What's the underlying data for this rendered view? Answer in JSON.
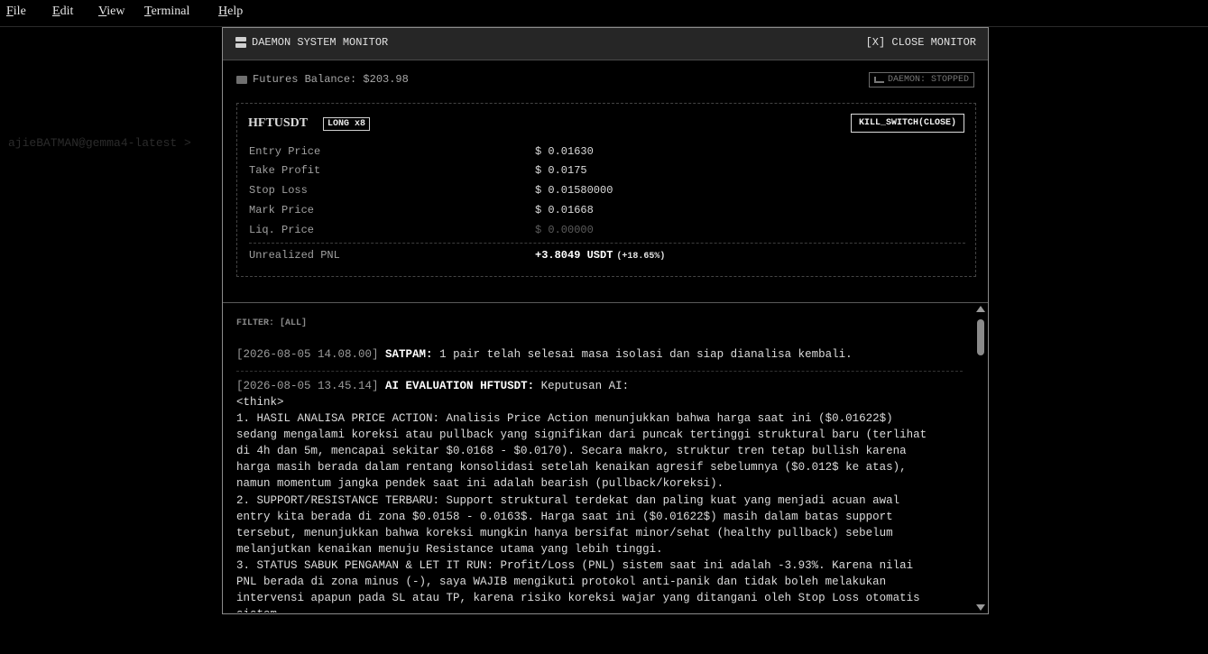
{
  "menu": {
    "items": [
      {
        "accel": "F",
        "rest": "ile"
      },
      {
        "accel": "E",
        "rest": "dit"
      },
      {
        "accel": "V",
        "rest": "iew"
      },
      {
        "accel": "T",
        "rest": "erminal"
      },
      {
        "accel": "H",
        "rest": "elp"
      }
    ]
  },
  "background": {
    "prompt": "ajieBATMAN@gemma4-latest >"
  },
  "monitor": {
    "title": "DAEMON SYSTEM MONITOR",
    "close_label": "[X] CLOSE MONITOR",
    "balance": "Futures Balance: $203.98",
    "daemon_status": "DAEMON: STOPPED",
    "position": {
      "symbol": "HFTUSDT",
      "side": "LONG x8",
      "kill_switch": "KILL_SWITCH(CLOSE)",
      "entry_label": "Entry Price",
      "entry_value": "$ 0.01630",
      "tp_label": "Take Profit",
      "tp_value": "$ 0.0175",
      "sl_label": "Stop Loss",
      "sl_value": "$ 0.01580000",
      "mark_label": "Mark Price",
      "mark_value": "$ 0.01668",
      "liq_label": "Liq. Price",
      "liq_value": "$ 0.00000",
      "pnl_label": "Unrealized PNL",
      "pnl_value": "+3.8049 USDT",
      "pnl_pct": "(+18.65%)"
    },
    "log": {
      "filter": "FILTER: [ALL]",
      "entries": [
        {
          "timestamp": "[2026-08-05 14.08.00]",
          "tag": "SATPAM:",
          "message": "1 pair telah selesai masa isolasi dan siap dianalisa kembali."
        },
        {
          "timestamp": "[2026-08-05 13.45.14]",
          "tag": "AI EVALUATION HFTUSDT:",
          "message": "Keputusan AI:",
          "body": "<think>\n1. HASIL ANALISA PRICE ACTION: Analisis Price Action menunjukkan bahwa harga saat ini ($0.01622$)\nsedang mengalami koreksi atau pullback yang signifikan dari puncak tertinggi struktural baru (terlihat\ndi 4h dan 5m, mencapai sekitar $0.0168 - $0.0170). Secara makro, struktur tren tetap bullish karena\nharga masih berada dalam rentang konsolidasi setelah kenaikan agresif sebelumnya ($0.012$ ke atas),\nnamun momentum jangka pendek saat ini adalah bearish (pullback/koreksi).\n2. SUPPORT/RESISTANCE TERBARU: Support struktural terdekat dan paling kuat yang menjadi acuan awal\nentry kita berada di zona $0.0158 - 0.0163$. Harga saat ini ($0.01622$) masih dalam batas support\ntersebut, menunjukkan bahwa koreksi mungkin hanya bersifat minor/sehat (healthy pullback) sebelum\nmelanjutkan kenaikan menuju Resistance utama yang lebih tinggi.\n3. STATUS SABUK PENGAMAN & LET IT RUN: Profit/Loss (PNL) sistem saat ini adalah -3.93%. Karena nilai\nPNL berada di zona minus (-), saya WAJIB mengikuti protokol anti-panik dan tidak boleh melakukan\nintervensi apapun pada SL atau TP, karena risiko koreksi wajar yang ditangani oleh Stop Loss otomatis\nsistem."
        }
      ]
    }
  }
}
